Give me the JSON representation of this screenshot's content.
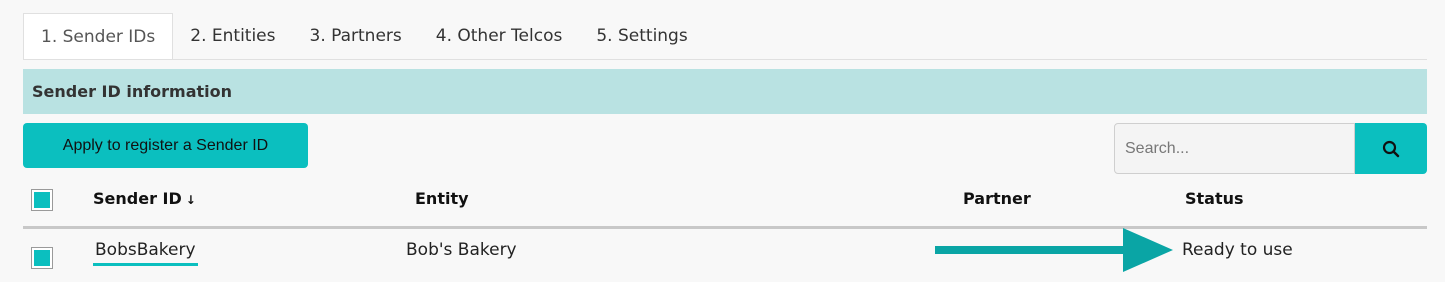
{
  "tabs": [
    {
      "label": "1. Sender IDs",
      "active": true
    },
    {
      "label": "2. Entities",
      "active": false
    },
    {
      "label": "3. Partners",
      "active": false
    },
    {
      "label": "4. Other Telcos",
      "active": false
    },
    {
      "label": "5. Settings",
      "active": false
    }
  ],
  "section": {
    "title": "Sender ID information"
  },
  "toolbar": {
    "apply_label": "Apply to register a Sender ID",
    "search_placeholder": "Search...",
    "search_icon": "magnifier-icon"
  },
  "table": {
    "headers": {
      "sender_id": "Sender ID",
      "sort_indicator": "↓",
      "entity": "Entity",
      "partner": "Partner",
      "status": "Status"
    },
    "rows": [
      {
        "sender_id": "BobsBakery",
        "entity": "Bob's Bakery",
        "partner": "",
        "status": "Ready to use",
        "checked": true
      }
    ]
  },
  "annotation": {
    "icon": "arrow-right-icon",
    "color": "#0aa5a5"
  },
  "colors": {
    "accent": "#0bbfbf",
    "section_bg": "#b9e2e2",
    "page_bg": "#f8f8f8"
  }
}
